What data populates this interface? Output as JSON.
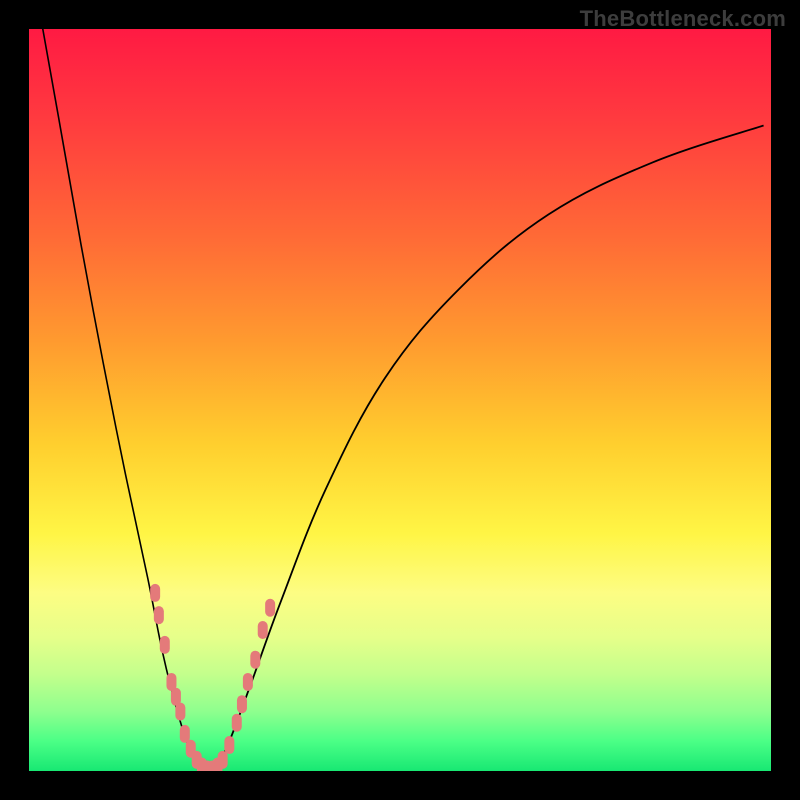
{
  "watermark": "TheBottleneck.com",
  "colors": {
    "frame": "#000000",
    "curve": "#000000",
    "scatter": "#e47a7a",
    "gradient_stops": [
      "#ff1a43",
      "#ff3a3f",
      "#ff6a36",
      "#ff9a2f",
      "#ffcf2e",
      "#fff545",
      "#fdfd83",
      "#e6ff8a",
      "#c3ff8c",
      "#8eff8e",
      "#4bff86",
      "#18e873"
    ]
  },
  "chart_data": {
    "type": "line",
    "title": "",
    "xlabel": "",
    "ylabel": "",
    "xlim": [
      0,
      100
    ],
    "ylim": [
      0,
      100
    ],
    "grid": false,
    "series": [
      {
        "name": "left-branch",
        "x": [
          1.5,
          4,
          7,
          10,
          13,
          16,
          18,
          20,
          22,
          23.5
        ],
        "values": [
          102,
          88,
          71,
          55,
          40,
          26,
          16,
          8,
          2,
          0
        ]
      },
      {
        "name": "right-branch",
        "x": [
          25,
          27,
          30,
          34,
          40,
          48,
          58,
          70,
          84,
          99
        ],
        "values": [
          0,
          4,
          12,
          23,
          38,
          53,
          65,
          75,
          82,
          87
        ]
      }
    ],
    "scatter": {
      "name": "highlight-points",
      "points": [
        {
          "x": 17.0,
          "y": 24
        },
        {
          "x": 17.5,
          "y": 21
        },
        {
          "x": 18.3,
          "y": 17
        },
        {
          "x": 19.2,
          "y": 12
        },
        {
          "x": 19.8,
          "y": 10
        },
        {
          "x": 20.4,
          "y": 8
        },
        {
          "x": 21.0,
          "y": 5
        },
        {
          "x": 21.8,
          "y": 3
        },
        {
          "x": 22.6,
          "y": 1.5
        },
        {
          "x": 23.3,
          "y": 0.6
        },
        {
          "x": 24.0,
          "y": 0.2
        },
        {
          "x": 24.7,
          "y": 0.2
        },
        {
          "x": 25.4,
          "y": 0.6
        },
        {
          "x": 26.1,
          "y": 1.5
        },
        {
          "x": 27.0,
          "y": 3.5
        },
        {
          "x": 28.0,
          "y": 6.5
        },
        {
          "x": 28.7,
          "y": 9
        },
        {
          "x": 29.5,
          "y": 12
        },
        {
          "x": 30.5,
          "y": 15
        },
        {
          "x": 31.5,
          "y": 19
        },
        {
          "x": 32.5,
          "y": 22
        }
      ]
    }
  }
}
